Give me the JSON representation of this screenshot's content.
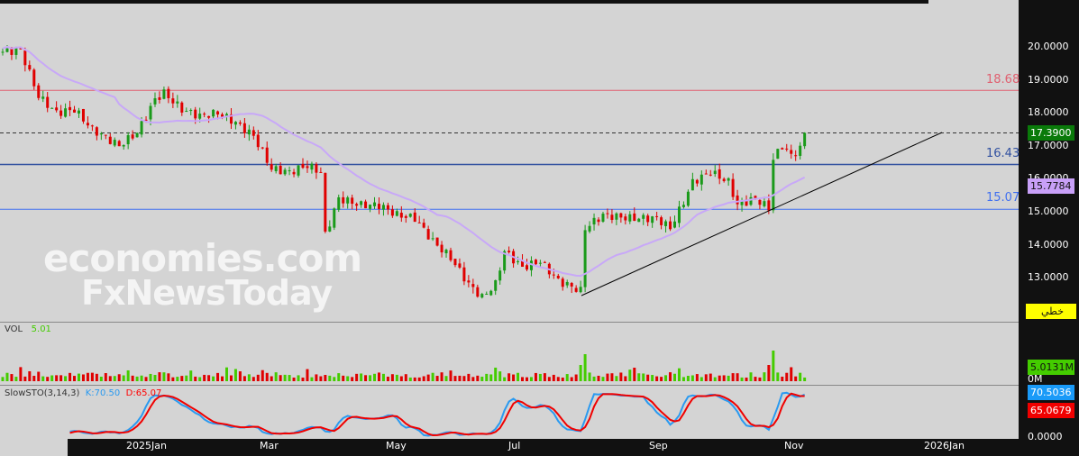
{
  "price_axis": [
    "20.0000",
    "19.0000",
    "18.0000",
    "17.0000",
    "16.0000",
    "15.0000",
    "14.0000",
    "13.0000"
  ],
  "tags": {
    "last": "17.3900",
    "ma": "15.7784",
    "tool": "خطي",
    "vol": "5.0131M",
    "vol_zero": "0M",
    "k": "70.5036",
    "d": "65.0679",
    "sto_zero": "0.0000"
  },
  "levels": [
    {
      "value": "18.68",
      "color": "#e06070"
    },
    {
      "value": "16.43",
      "color": "#3050a0"
    },
    {
      "value": "15.07",
      "color": "#4070f0"
    }
  ],
  "time_axis": [
    "2025Jan",
    "Mar",
    "May",
    "Jul",
    "Sep",
    "Nov",
    "2026Jan"
  ],
  "vol_panel": {
    "name": "VOL",
    "value": "5.01"
  },
  "sto_panel": {
    "name": "SlowSTO(3,14,3)",
    "k": "K:70.50",
    "d": "D:65.07"
  },
  "watermark": {
    "line1": "economies.com",
    "line2": "FxNewsToday"
  },
  "colors": {
    "up": "#1a9a1a",
    "down": "#e00000",
    "ma": "#c8a8f8",
    "k": "#2a9af0",
    "d": "#f00000"
  },
  "chart_data": {
    "type": "candlestick",
    "price_keypoints": [
      [
        0,
        19.85
      ],
      [
        4,
        19.9
      ],
      [
        8,
        18.5
      ],
      [
        12,
        18.0
      ],
      [
        16,
        18.1
      ],
      [
        20,
        17.5
      ],
      [
        26,
        17.0
      ],
      [
        30,
        17.4
      ],
      [
        34,
        18.4
      ],
      [
        36,
        18.6
      ],
      [
        40,
        18.1
      ],
      [
        44,
        17.9
      ],
      [
        48,
        18.0
      ],
      [
        52,
        17.7
      ],
      [
        56,
        17.3
      ],
      [
        60,
        16.3
      ],
      [
        64,
        16.2
      ],
      [
        68,
        16.4
      ],
      [
        71,
        16.2
      ],
      [
        72,
        14.3
      ],
      [
        75,
        15.4
      ],
      [
        80,
        15.2
      ],
      [
        84,
        15.2
      ],
      [
        88,
        14.9
      ],
      [
        92,
        14.8
      ],
      [
        96,
        14.1
      ],
      [
        100,
        13.6
      ],
      [
        104,
        12.8
      ],
      [
        107,
        12.4
      ],
      [
        110,
        12.8
      ],
      [
        112,
        13.8
      ],
      [
        116,
        13.3
      ],
      [
        120,
        13.5
      ],
      [
        124,
        12.9
      ],
      [
        129,
        12.6
      ],
      [
        130,
        14.5
      ],
      [
        134,
        14.9
      ],
      [
        140,
        14.8
      ],
      [
        146,
        14.8
      ],
      [
        149,
        14.5
      ],
      [
        152,
        15.3
      ],
      [
        154,
        15.9
      ],
      [
        158,
        16.2
      ],
      [
        162,
        15.9
      ],
      [
        164,
        15.2
      ],
      [
        168,
        15.4
      ],
      [
        171,
        15.1
      ],
      [
        172,
        16.6
      ],
      [
        174,
        17.0
      ],
      [
        176,
        16.7
      ],
      [
        178,
        16.9
      ],
      [
        179,
        17.39
      ]
    ],
    "ylim": [
      12,
      20.5
    ]
  }
}
